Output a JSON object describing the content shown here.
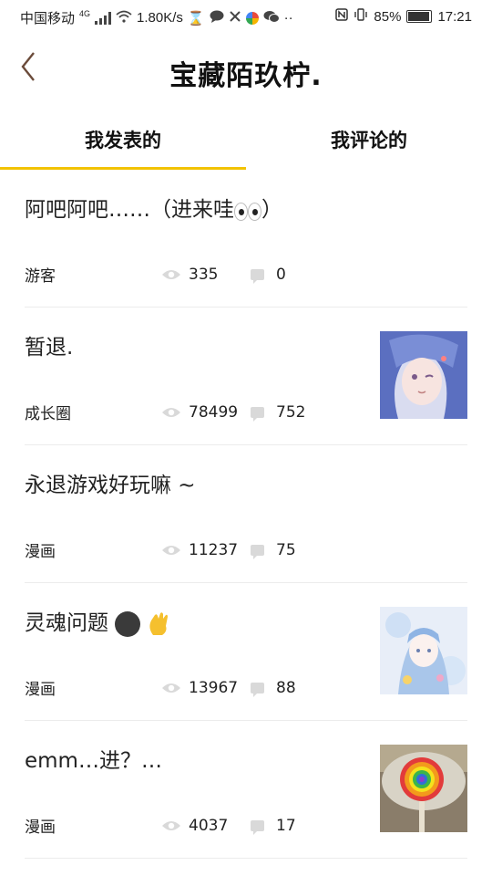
{
  "status_bar": {
    "carrier": "中国移动",
    "network": "4G",
    "speed": "1.80K/s",
    "battery": "85%",
    "time": "17:21"
  },
  "header": {
    "back_icon": "chevron-left-icon",
    "title": "宝藏陌玖柠."
  },
  "tabs": [
    {
      "label": "我发表的",
      "active": true
    },
    {
      "label": "我评论的",
      "active": false
    }
  ],
  "posts": [
    {
      "title": "阿吧阿吧……（进来哇",
      "emoji": "eyes",
      "title_end": "）",
      "category": "游客",
      "views": "335",
      "comments": "0",
      "has_thumbnail": false
    },
    {
      "title": "暂退.",
      "category": "成长圈",
      "views": "78499",
      "comments": "752",
      "has_thumbnail": true,
      "thumbnail": "anime-girl-blue-hair"
    },
    {
      "title": "永退游戏好玩嘛 ~",
      "category": "漫画",
      "views": "11237",
      "comments": "75",
      "has_thumbnail": false
    },
    {
      "title": "灵魂问题",
      "emoji": "face-and-clap",
      "category": "漫画",
      "views": "13967",
      "comments": "88",
      "has_thumbnail": true,
      "thumbnail": "anime-girl-light-blue"
    },
    {
      "title": "emm…进？…",
      "category": "漫画",
      "views": "4037",
      "comments": "17",
      "has_thumbnail": true,
      "thumbnail": "rainbow-lollipop"
    }
  ],
  "colors": {
    "tab_indicator": "#f2c300",
    "back_arrow": "#6b4b3a",
    "meta_icon": "#d9d9d9"
  }
}
